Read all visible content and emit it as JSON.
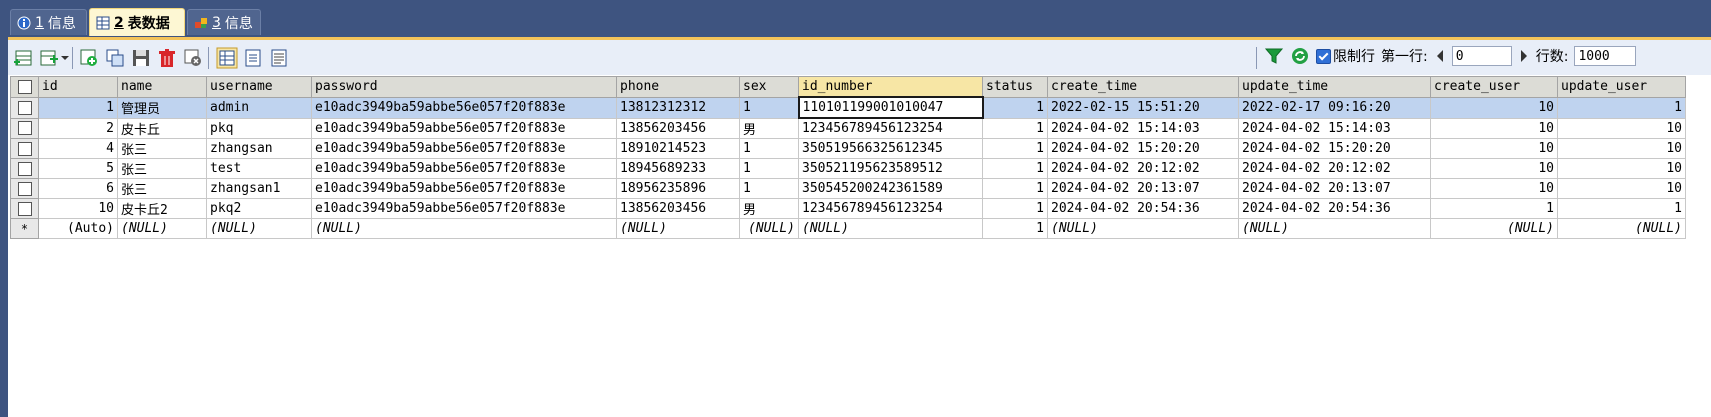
{
  "tabs": [
    {
      "num": "1",
      "label": "信息"
    },
    {
      "num": "2",
      "label": "表数据"
    },
    {
      "num": "3",
      "label": "信息"
    }
  ],
  "toolbar": {
    "limit_label": "限制行",
    "first_row_label": "第一行:",
    "first_row_value": "0",
    "rows_label": "行数:",
    "rows_value": "1000"
  },
  "columns": [
    "id",
    "name",
    "username",
    "password",
    "phone",
    "sex",
    "id_number",
    "status",
    "create_time",
    "update_time",
    "create_user",
    "update_user"
  ],
  "rows": [
    [
      "1",
      "管理员",
      "admin",
      "e10adc3949ba59abbe56e057f20f883e",
      "13812312312",
      "1",
      "110101199001010047",
      "1",
      "2022-02-15 15:51:20",
      "2022-02-17 09:16:20",
      "10",
      "1"
    ],
    [
      "2",
      "皮卡丘",
      "pkq",
      "e10adc3949ba59abbe56e057f20f883e",
      "13856203456",
      "男",
      "123456789456123254",
      "1",
      "2024-04-02 15:14:03",
      "2024-04-02 15:14:03",
      "10",
      "10"
    ],
    [
      "4",
      "张三",
      "zhangsan",
      "e10adc3949ba59abbe56e057f20f883e",
      "18910214523",
      "1",
      "350519566325612345",
      "1",
      "2024-04-02 15:20:20",
      "2024-04-02 15:20:20",
      "10",
      "10"
    ],
    [
      "5",
      "张三",
      "test",
      "e10adc3949ba59abbe56e057f20f883e",
      "18945689233",
      "1",
      "350521195623589512",
      "1",
      "2024-04-02 20:12:02",
      "2024-04-02 20:12:02",
      "10",
      "10"
    ],
    [
      "6",
      "张三",
      "zhangsan1",
      "e10adc3949ba59abbe56e057f20f883e",
      "18956235896",
      "1",
      "350545200242361589",
      "1",
      "2024-04-02 20:13:07",
      "2024-04-02 20:13:07",
      "10",
      "10"
    ],
    [
      "10",
      "皮卡丘2",
      "pkq2",
      "e10adc3949ba59abbe56e057f20f883e",
      "13856203456",
      "男",
      "123456789456123254",
      "1",
      "2024-04-02 20:54:36",
      "2024-04-02 20:54:36",
      "1",
      "1"
    ]
  ],
  "new_row": {
    "marker": "*",
    "values": [
      "(Auto)",
      "(NULL)",
      "(NULL)",
      "(NULL)",
      "(NULL)",
      "(NULL)",
      "(NULL)",
      "1",
      "(NULL)",
      "(NULL)",
      "(NULL)",
      "(NULL)"
    ]
  },
  "colors": {
    "tab_active": "#fdf7d3",
    "selected_row": "#bfd3ef",
    "header": "#dcdcd6",
    "accent": "#f3c35a"
  }
}
